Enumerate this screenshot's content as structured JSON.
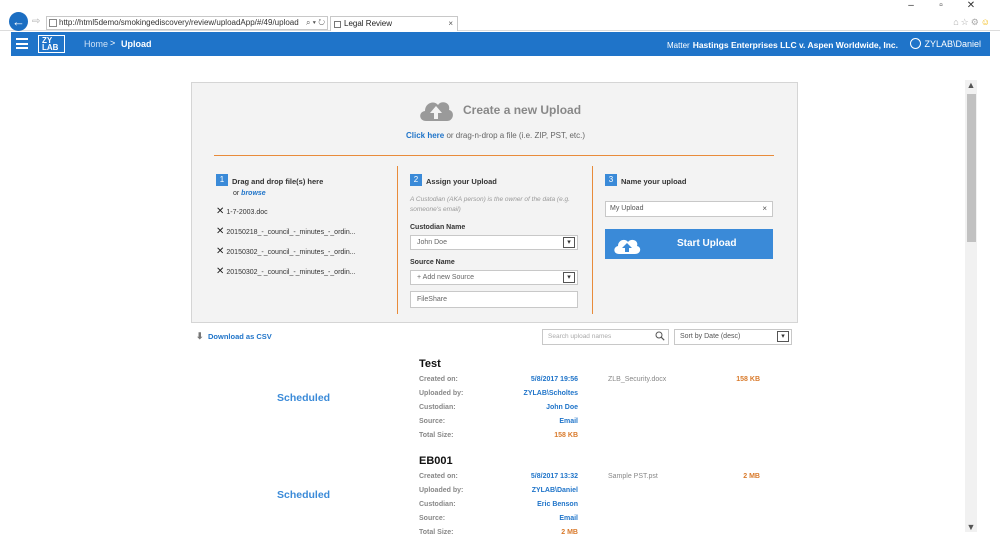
{
  "browser": {
    "url": "http://html5demo/smokingediscovery/review/uploadApp/#/49/upload",
    "addr_controls": "⌕ ▾ ↻",
    "tab_title": "Legal Review",
    "tab_close": "×",
    "back_glyph": "←",
    "forward_glyph": "⇨",
    "window_controls": [
      "–",
      "▫",
      "✕"
    ],
    "tool_icons": [
      "⌂",
      "☆",
      "⚙",
      "☺"
    ]
  },
  "header": {
    "logo": "ZYLAB",
    "breadcrumb_home": "Home",
    "breadcrumb_sep": ">",
    "breadcrumb_current": "Upload",
    "matter_label": "Matter",
    "matter_name": "Hastings Enterprises LLC v. Aspen Worldwide, Inc.",
    "user": "ZYLAB\\Daniel"
  },
  "scrollbar": {
    "up": "▲",
    "down": "▼"
  },
  "create": {
    "title": "Create a new Upload",
    "click_here": "Click here",
    "sub_rest": " or drag-n-drop a file (i.e. ZIP, PST, etc.)"
  },
  "step1": {
    "num": "1",
    "title": "Drag and drop file(s) here",
    "or": "or ",
    "browse": "browse",
    "files": [
      "1-7-2003.doc",
      "20150218_-_council_-_minutes_-_ordin...",
      "20150302_-_council_-_minutes_-_ordin...",
      "20150302_-_council_-_minutes_-_ordin..."
    ],
    "remove_glyph": "✕"
  },
  "step2": {
    "num": "2",
    "title": "Assign your Upload",
    "hint": "A Custodian (AKA person) is the owner of the data (e.g. someone's email)",
    "custodian_label": "Custodian Name",
    "custodian_value": "John Doe",
    "source_label": "Source Name",
    "source_value": "+ Add new Source",
    "source_input": "FileShare",
    "dropdown_glyph": "▾"
  },
  "step3": {
    "num": "3",
    "title": "Name your upload",
    "name_value": "My Upload",
    "clear_glyph": "×",
    "start_button": "Start Upload"
  },
  "toolbar": {
    "csv_label": "Download as CSV",
    "csv_icon": "⬇",
    "search_placeholder": "Search upload names",
    "sort_value": "Sort by Date (desc)",
    "dropdown_glyph": "▾"
  },
  "record_labels": [
    "Created on:",
    "Uploaded by:",
    "Custodian:",
    "Source:",
    "Total Size:"
  ],
  "uploads": [
    {
      "status": "Scheduled",
      "title": "Test",
      "created": "5/8/2017 19:56",
      "uploaded_by": "ZYLAB\\Scholtes",
      "custodian": "John Doe",
      "source": "Email",
      "total_size": "158 KB",
      "file_name": "ZLB_Security.docx",
      "file_size": "158 KB"
    },
    {
      "status": "Scheduled",
      "title": "EB001",
      "created": "5/8/2017 13:32",
      "uploaded_by": "ZYLAB\\Daniel",
      "custodian": "Eric Benson",
      "source": "Email",
      "total_size": "2 MB",
      "file_name": "Sample PST.pst",
      "file_size": "2 MB"
    }
  ]
}
